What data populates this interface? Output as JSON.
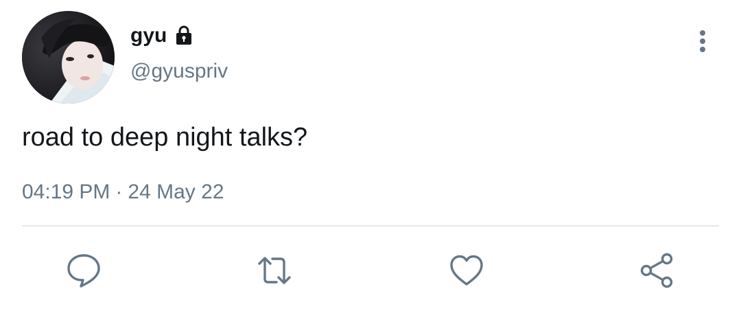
{
  "author": {
    "display_name": "gyu",
    "handle": "@gyuspriv",
    "protected": true
  },
  "tweet": {
    "text": "road to deep night talks?",
    "time": "04:19 PM",
    "separator": "·",
    "date": "24 May 22"
  },
  "icons": {
    "lock": "lock-icon",
    "more": "more-vertical-icon",
    "reply": "reply-icon",
    "retweet": "retweet-icon",
    "like": "heart-icon",
    "share": "share-icon"
  },
  "colors": {
    "text_primary": "#14171a",
    "text_secondary": "#657786",
    "divider": "#e1e8ed",
    "icon": "#657786"
  }
}
